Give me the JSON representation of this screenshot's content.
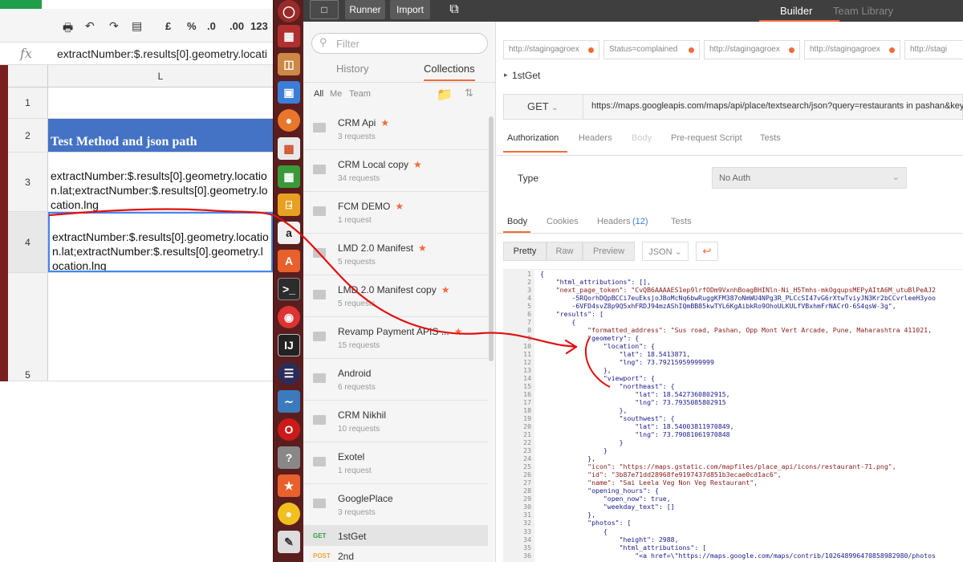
{
  "sheet": {
    "formula": "extractNumber:$.results[0].geometry.locati",
    "column": "L",
    "toolbar": {
      "currency": "£",
      "percent": "%",
      "dec_less": ".0",
      "dec_more": ".00",
      "format": "123"
    },
    "rows": [
      {
        "num": "1",
        "text": ""
      },
      {
        "num": "2",
        "text": "Test Method and json path"
      },
      {
        "num": "3",
        "text": "extractNumber:$.results[0].geometry.location.lat;extractNumber:$.results[0].geometry.location.lng"
      },
      {
        "num": "4",
        "text": "extractNumber:$.results[0].geometry.location.lat;extractNumber:$.results[0].geometry.location.lng"
      },
      {
        "num": "5",
        "text": ""
      }
    ]
  },
  "topbar": {
    "runner": "Runner",
    "import": "Import",
    "builder": "Builder",
    "team_library": "Team Library"
  },
  "sidebar": {
    "filter_placeholder": "Filter",
    "tab_history": "History",
    "tab_collections": "Collections",
    "scope": [
      "All",
      "Me",
      "Team"
    ],
    "collections": [
      {
        "name": "CRM Api",
        "requests": "3 requests",
        "starred": true
      },
      {
        "name": "CRM Local copy",
        "requests": "34 requests",
        "starred": true
      },
      {
        "name": "FCM DEMO",
        "requests": "1 request",
        "starred": true
      },
      {
        "name": "LMD 2.0 Manifest",
        "requests": "5 requests",
        "starred": true
      },
      {
        "name": "LMD 2.0 Manifest copy",
        "requests": "5 requests",
        "starred": true
      },
      {
        "name": "Revamp Payment APIS ...",
        "requests": "15 requests",
        "starred": true
      },
      {
        "name": "Android",
        "requests": "6 requests",
        "starred": false
      },
      {
        "name": "CRM Nikhil",
        "requests": "10 requests",
        "starred": false
      },
      {
        "name": "Exotel",
        "requests": "1 request",
        "starred": false
      },
      {
        "name": "GooglePlace",
        "requests": "3 requests",
        "starred": false
      }
    ],
    "requests": [
      {
        "method": "GET",
        "name": "1stGet",
        "color": "#2f9e41"
      },
      {
        "method": "POST",
        "name": "2nd",
        "color": "#f2a63a"
      }
    ],
    "star": "★"
  },
  "builder": {
    "request_tabs": [
      "http://stagingagroex",
      "Status=complained",
      "http://stagingagroex",
      "http://stagingagroex",
      "http://stagi"
    ],
    "request_name": "1stGet",
    "method": "GET",
    "url": "https://maps.googleapis.com/maps/api/place/textsearch/json?query=restaurants in pashan&key=",
    "sub_tabs": [
      "Authorization",
      "Headers",
      "Body",
      "Pre-request Script",
      "Tests"
    ],
    "type_label": "Type",
    "auth_value": "No Auth",
    "response_tabs": {
      "body": "Body",
      "cookies": "Cookies",
      "headers": "Headers",
      "headers_count": "(12)",
      "tests": "Tests"
    },
    "view": {
      "pretty": "Pretty",
      "raw": "Raw",
      "preview": "Preview",
      "format": "JSON"
    },
    "code_lines": [
      "{",
      "    \"html_attributions\": [],",
      "    \"next_page_token\": \"CvQB6AAAAES1ep9lrfODm9VxnhBoagBHINln-Ni_H5Tmhs-mkOgqupsMEPyAItA6M_utuBlPeAJ2",
      "        -5RQorhDQpBCCi7euEksjoJBoMcNq6bwRuggKFM387oNmWU4NPg3R_PLCcSI47vG6rXtwTviyJN3Kr2bCCvrleeH3yoo",
      "        -6VFD4svZ8p9Q5xhFRDJ94mzAShIQmBB85kwTYL6KgAibkRo9OhoULKULfVBxhmFrNACrO-6S4qsW-3g\",",
      "    \"results\": [",
      "        {",
      "            \"formatted_address\": \"Sus road, Pashan, Opp Mont Vert Arcade, Pune, Maharashtra 411021,",
      "            \"geometry\": {",
      "                \"location\": {",
      "                    \"lat\": 18.5413871,",
      "                    \"lng\": 73.79215959999999",
      "                },",
      "                \"viewport\": {",
      "                    \"northeast\": {",
      "                        \"lat\": 18.5427360802915,",
      "                        \"lng\": 73.7935085802915",
      "                    },",
      "                    \"southwest\": {",
      "                        \"lat\": 18.54003811970849,",
      "                        \"lng\": 73.79081061970848",
      "                    }",
      "                }",
      "            },",
      "            \"icon\": \"https://maps.gstatic.com/mapfiles/place_api/icons/restaurant-71.png\",",
      "            \"id\": \"3b87e71dd28968fe9197437d851b3ecae0cd1ac6\",",
      "            \"name\": \"Sai Leela Veg Non Veg Restaurant\",",
      "            \"opening_hours\": {",
      "                \"open_now\": true,",
      "                \"weekday_text\": []",
      "            },",
      "            \"photos\": [",
      "                {",
      "                    \"height\": 2988,",
      "                    \"html_attributions\": [",
      "                        \"<a href=\\\"https://maps.google.com/maps/contrib/102648996470858982980/photos"
    ]
  }
}
